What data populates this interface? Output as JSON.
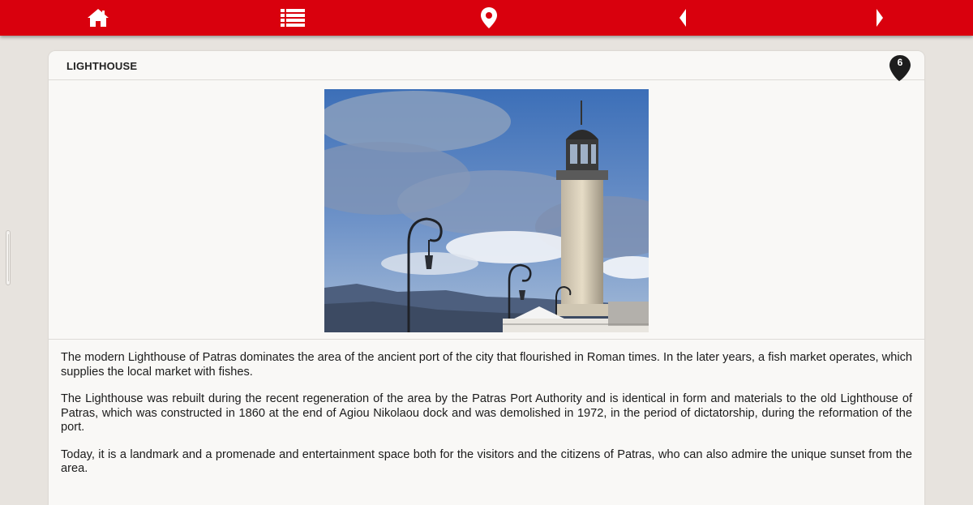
{
  "toolbar": {
    "icons": [
      "home-icon",
      "list-icon",
      "map-pin-icon",
      "previous-icon",
      "next-icon"
    ],
    "accent_color": "#d9000d"
  },
  "card": {
    "title": "LIGHTHOUSE",
    "badge_count": "6"
  },
  "content": {
    "paragraphs": [
      "The modern Lighthouse of Patras dominates the area of the ancient port of the city that flourished in Roman times. In the later years, a fish market operates, which supplies the local market with fishes.",
      "The Lighthouse was rebuilt during the recent regeneration of the area by the Patras Port Authority and is identical in form and materials to the old Lighthouse of Patras, which was constructed in 1860 at the end of Agiou Nikolaou dock and was demolished in 1972, in the period of dictatorship, during the reformation of the port.",
      "Today, it is a landmark and a promenade and entertainment space both for the visitors and the citizens of Patras, who can also admire the unique sunset from the area."
    ]
  }
}
